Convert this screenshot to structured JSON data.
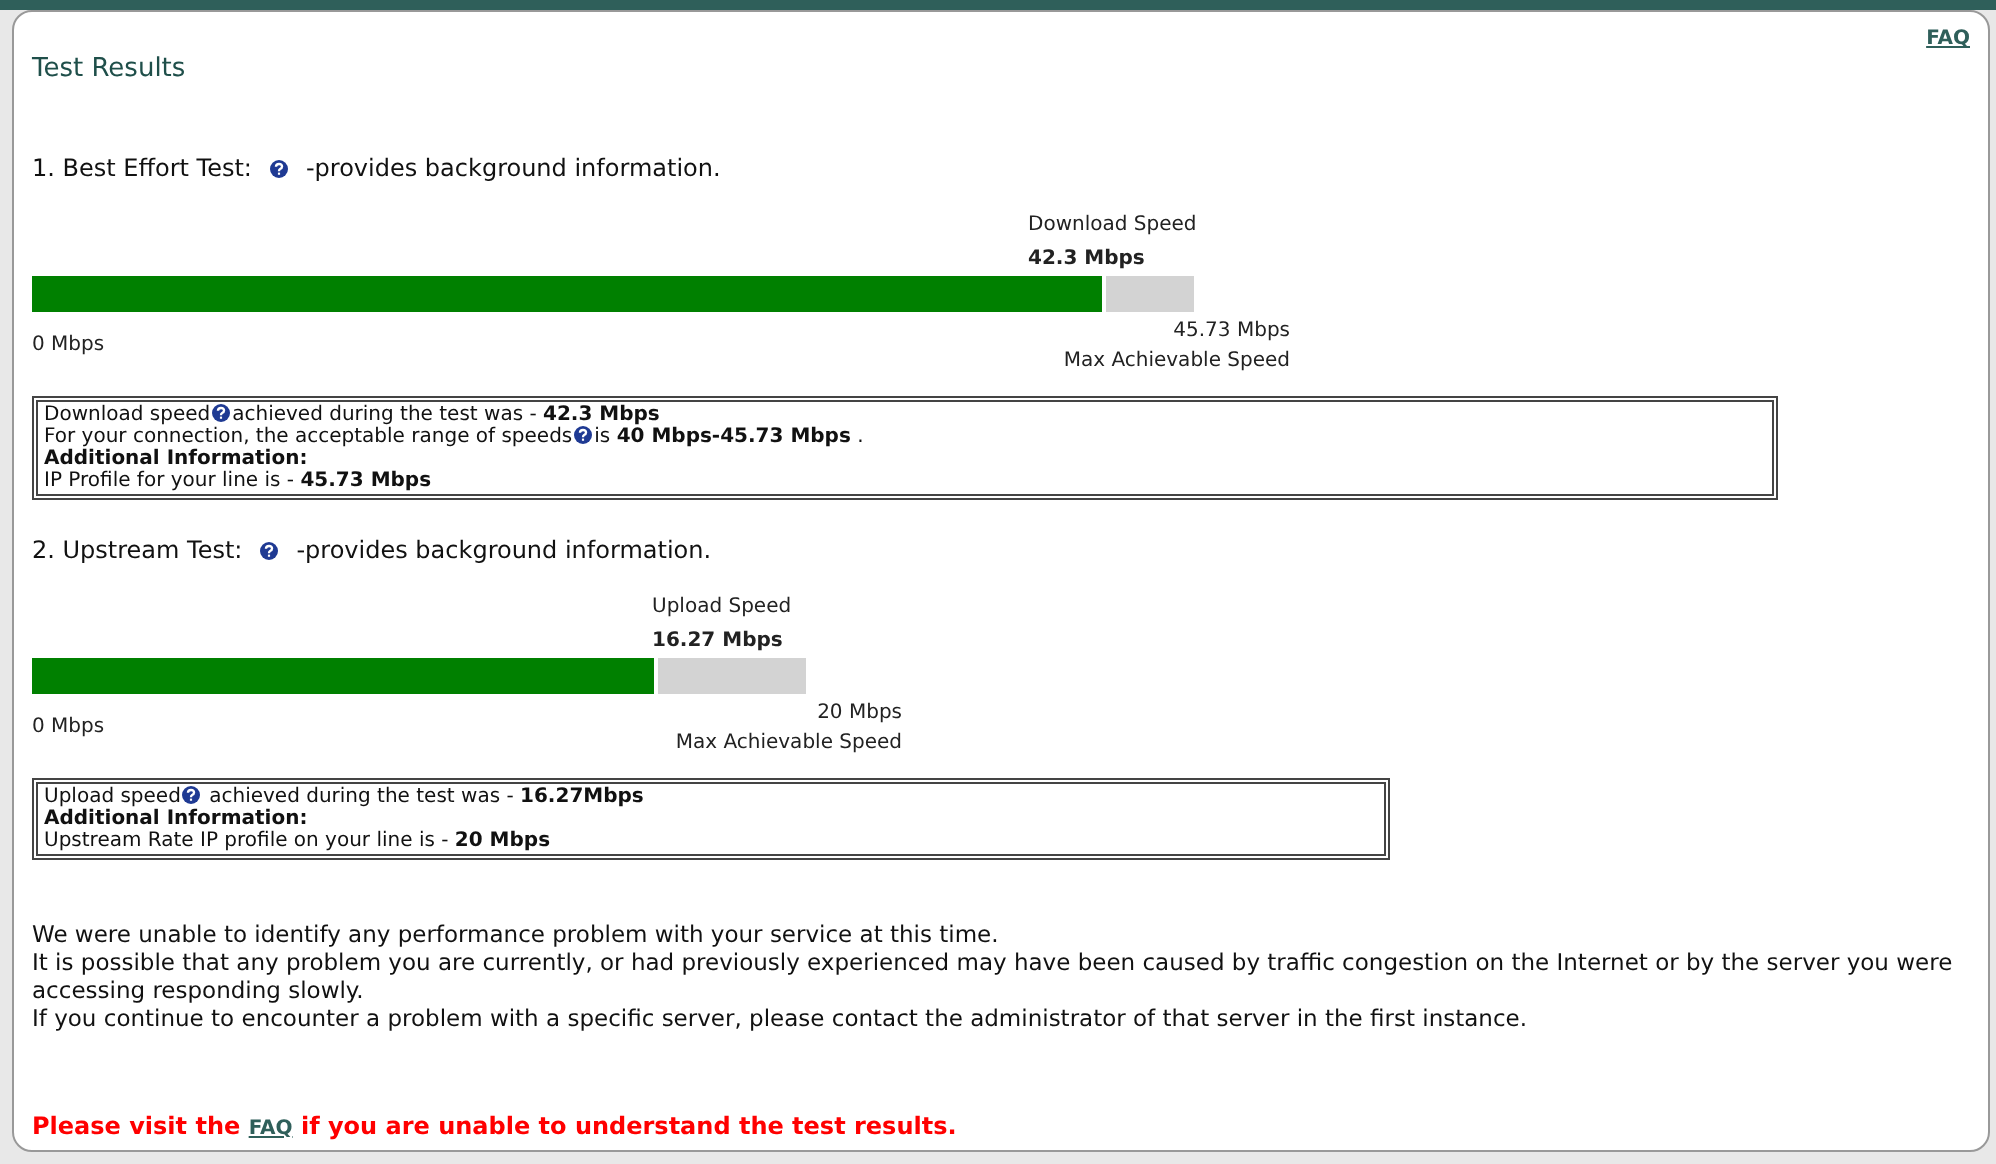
{
  "title": "Test Results",
  "faq_link": "FAQ",
  "tests": [
    {
      "heading": "1. Best Effort Test:",
      "heading_note": "-provides background information.",
      "speed_label": "Download Speed",
      "speed_value": "42.3 Mbps",
      "level": 0.925,
      "min_label": "0 Mbps",
      "max_label": "45.73 Mbps",
      "max_caption": "Max Achievable Speed",
      "info_lines": [
        {
          "parts": [
            "Download speed",
            "achieved during the test was - **42.3 Mbps**"
          ]
        },
        {
          "parts": [
            "For your connection, the acceptable range of speeds",
            "is **40 Mbps-45.73 Mbps** ."
          ]
        },
        {
          "parts": [
            "Additional Information:"
          ],
          "bold": true
        },
        {
          "parts": [
            "IP Profile for your line is - **45.73 Mbps**"
          ]
        }
      ]
    },
    {
      "heading": "2. Upstream Test:",
      "heading_note": "-provides background information.",
      "speed_label": "Upload Speed",
      "speed_value": "16.27 Mbps",
      "level": 0.81,
      "min_label": "0 Mbps",
      "max_label": "20 Mbps",
      "max_caption": "Max Achievable Speed",
      "info_lines": [
        {
          "parts": [
            "Upload speed",
            " achieved during the test was - **16.27Mbps**"
          ]
        },
        {
          "parts": [
            "Additional Information:"
          ],
          "bold": true
        },
        {
          "parts": [
            "Upstream Rate IP profile on your line is - **20 Mbps**"
          ]
        }
      ]
    }
  ],
  "summary": [
    "We were unable to identify any performance problem with your service at this time.",
    "It is possible that any problem you are currently, or had previously experienced may have been caused by traffic congestion on the Internet or by the server you were accessing responding slowly.",
    "If you continue to encounter a problem with a specific server, please contact the administrator of that server in the first instance."
  ],
  "footer": {
    "before": "Please visit the",
    "link": "FAQ",
    "after": "if you are unable to understand the test results."
  }
}
